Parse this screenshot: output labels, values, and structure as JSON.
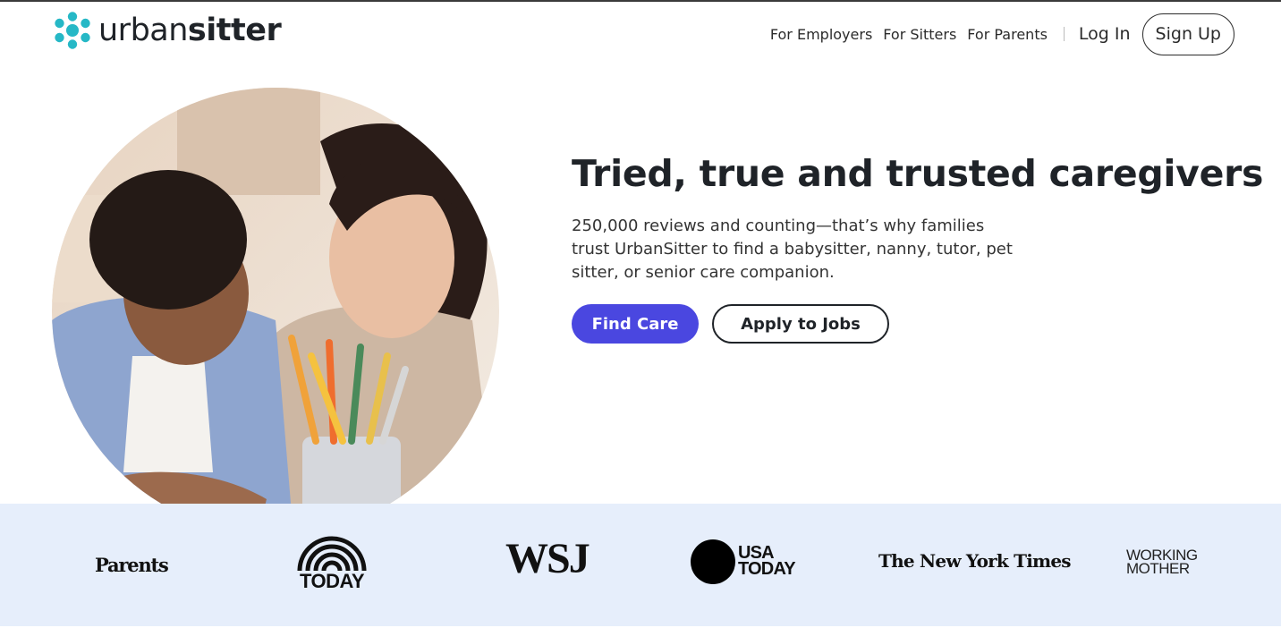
{
  "header": {
    "logo": {
      "word_light": "urban",
      "word_bold": "sitter",
      "icon": "dots-cluster-logo-icon",
      "color": "#26b8c6"
    },
    "nav": [
      {
        "label": "For Employers"
      },
      {
        "label": "For Sitters"
      },
      {
        "label": "For Parents"
      }
    ],
    "login_label": "Log In",
    "signup_label": "Sign Up"
  },
  "hero": {
    "image": "mother-and-child-drawing-photo",
    "headline": "Tried, true and trusted caregivers",
    "subtext": "250,000 reviews and counting—that’s why families trust UrbanSitter to find a babysitter, nanny, tutor, pet sitter, or senior care companion.",
    "primary_cta": "Find Care",
    "secondary_cta": "Apply to Jobs",
    "accent_color": "#4a47e0"
  },
  "press": {
    "background": "#e6eefb",
    "logos": {
      "parents": "Parents",
      "today": "TODAY",
      "wsj": "WSJ",
      "usa_today_line1": "USA",
      "usa_today_line2": "TODAY",
      "nyt": "The New York Times",
      "working_mother_line1": "WORKING",
      "working_mother_line2": "MOTHER"
    }
  }
}
